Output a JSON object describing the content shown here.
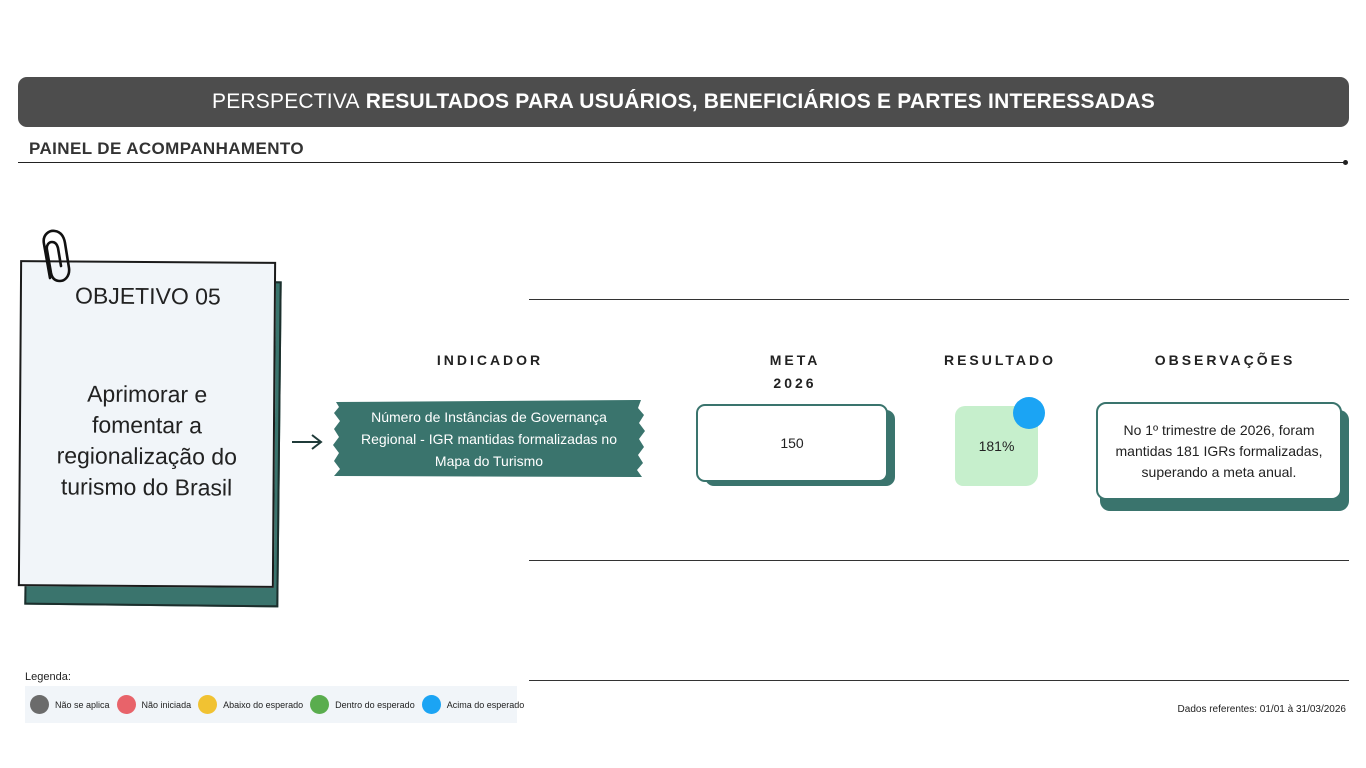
{
  "header": {
    "prefix": "PERSPECTIVA",
    "title": "RESULTADOS PARA USUÁRIOS, BENEFICIÁRIOS E PARTES INTERESSADAS"
  },
  "subtitle": "PAINEL DE ACOMPANHAMENTO",
  "objective": {
    "label": "OBJETIVO 05",
    "text": "Aprimorar e fomentar a regionalização do turismo do Brasil"
  },
  "columns": {
    "indicator": "INDICADOR",
    "meta_line1": "META",
    "meta_line2": "2026",
    "result": "RESULTADO",
    "observations": "OBSERVAÇÕES"
  },
  "row": {
    "indicator": "Número de Instâncias de Governança Regional - IGR mantidas formalizadas no Mapa do Turismo",
    "meta": "150",
    "result": "181%",
    "result_status": "acima",
    "observation": "No 1º trimestre de 2026, foram mantidas 181 IGRs formalizadas, superando a meta anual."
  },
  "legend": {
    "title": "Legenda:",
    "items": [
      {
        "label": "Não se aplica",
        "color": "#6b6b6b"
      },
      {
        "label": "Não iniciada",
        "color": "#e8636a"
      },
      {
        "label": "Abaixo do esperado",
        "color": "#f1c232"
      },
      {
        "label": "Dentro do esperado",
        "color": "#5aad4e"
      },
      {
        "label": "Acima do esperado",
        "color": "#1ba4f4"
      }
    ]
  },
  "footer": "Dados referentes: 01/01 à 31/03/2026",
  "colors": {
    "banner": "#4d4d4d",
    "teal": "#3a746d",
    "result_bg": "#c6efcc",
    "status_blue": "#1ba4f4"
  }
}
